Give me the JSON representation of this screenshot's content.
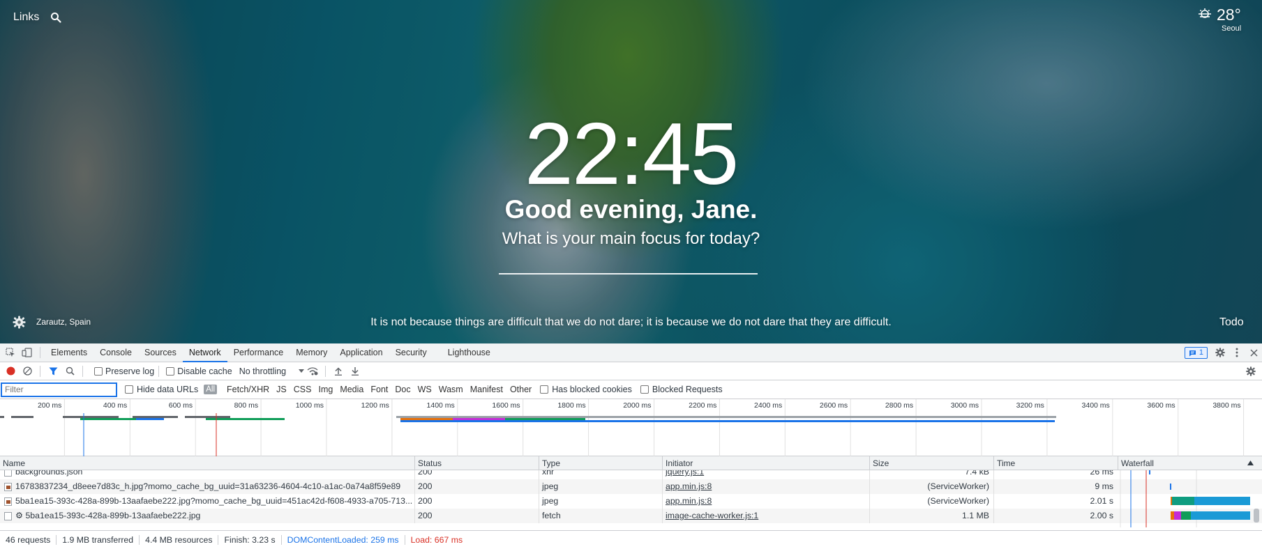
{
  "momentum": {
    "links_label": "Links",
    "temperature": "28°",
    "city": "Seoul",
    "clock": "22:45",
    "greeting": "Good evening, Jane.",
    "focus_prompt": "What is your main focus for today?",
    "location": "Zarautz, Spain",
    "quote": "It is not because things are difficult that we do not dare; it is because we do not dare that they are difficult.",
    "todo_label": "Todo"
  },
  "devtools": {
    "tabs": [
      "Elements",
      "Console",
      "Sources",
      "Network",
      "Performance",
      "Memory",
      "Application",
      "Security",
      "Lighthouse"
    ],
    "active_tab": "Network",
    "message_count": "1",
    "toolbar": {
      "preserve_log": "Preserve log",
      "disable_cache": "Disable cache",
      "throttling": "No throttling"
    },
    "filter": {
      "placeholder": "Filter",
      "hide_data_urls": "Hide data URLs",
      "all": "All",
      "types": [
        "Fetch/XHR",
        "JS",
        "CSS",
        "Img",
        "Media",
        "Font",
        "Doc",
        "WS",
        "Wasm",
        "Manifest",
        "Other"
      ],
      "has_blocked_cookies": "Has blocked cookies",
      "blocked_requests": "Blocked Requests"
    },
    "overview_ticks": [
      "200 ms",
      "400 ms",
      "600 ms",
      "800 ms",
      "1000 ms",
      "1200 ms",
      "1400 ms",
      "1600 ms",
      "1800 ms",
      "2000 ms",
      "2200 ms",
      "2400 ms",
      "2600 ms",
      "2800 ms",
      "3000 ms",
      "3200 ms",
      "3400 ms",
      "3600 ms",
      "3800 ms"
    ],
    "columns": {
      "name": "Name",
      "status": "Status",
      "type": "Type",
      "initiator": "Initiator",
      "size": "Size",
      "time": "Time",
      "waterfall": "Waterfall"
    },
    "rows": [
      {
        "name": "backgrounds.json",
        "status": "200",
        "type": "xhr",
        "initiator": "jquery.js:1",
        "size": "7.4 kB",
        "time": "26 ms"
      },
      {
        "name": "16783837234_d8eee7d83c_h.jpg?momo_cache_bg_uuid=31a63236-4604-4c10-a1ac-0a74a8f59e89",
        "status": "200",
        "type": "jpeg",
        "initiator": "app.min.js:8",
        "size": "(ServiceWorker)",
        "time": "9 ms"
      },
      {
        "name": "5ba1ea15-393c-428a-899b-13aafaebe222.jpg?momo_cache_bg_uuid=451ac42d-f608-4933-a705-713...",
        "status": "200",
        "type": "jpeg",
        "initiator": "app.min.js:8",
        "size": "(ServiceWorker)",
        "time": "2.01 s"
      },
      {
        "name": "⚙ 5ba1ea15-393c-428a-899b-13aafaebe222.jpg",
        "status": "200",
        "type": "fetch",
        "initiator": "image-cache-worker.js:1",
        "size": "1.1 MB",
        "time": "2.00 s"
      }
    ],
    "status": {
      "requests": "46 requests",
      "transferred": "1.9 MB transferred",
      "resources": "4.4 MB resources",
      "finish": "Finish: 3.23 s",
      "dom_content_loaded": "DOMContentLoaded: 259 ms",
      "load": "Load: 667 ms"
    },
    "colors": {
      "accent": "#1a73e8",
      "dom_content_loaded": "#1a73e8",
      "load": "#d93025",
      "record": "#d93025"
    }
  }
}
